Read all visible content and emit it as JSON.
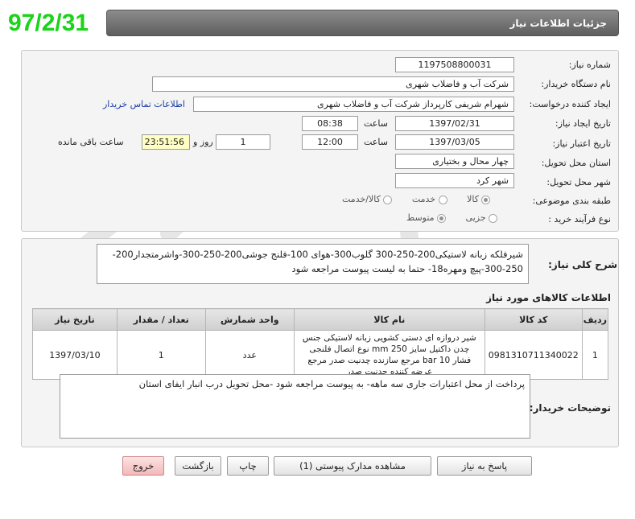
{
  "date_stamp": "97/2/31",
  "header": {
    "title": "جزئیات اطلاعات نیاز"
  },
  "form": {
    "need_number_label": "شماره نیاز:",
    "need_number": "1197508800031",
    "buyer_org_label": "نام دستگاه خریدار:",
    "buyer_org": "شرکت آب و فاضلاب شهری",
    "requester_label": "ایجاد کننده درخواست:",
    "requester": "شهرام  شریفی  کارپرداز  شرکت آب و فاضلاب شهری",
    "buyer_contact_link": "اطلاعات تماس خریدار",
    "created_label": "تاریخ ایجاد نیاز:",
    "created_date": "1397/02/31",
    "time_label": "ساعت",
    "created_time": "08:38",
    "validity_label": "تاریخ اعتبار نیاز:",
    "validity_date": "1397/03/05",
    "validity_time": "12:00",
    "days_remaining": "1",
    "day_and_label": "روز و",
    "time_remaining": "23:51:56",
    "time_remaining_label": "ساعت باقی مانده",
    "province_label": "استان محل تحویل:",
    "province": "چهار محال و بختیاری",
    "city_label": "شهر محل تحویل:",
    "city": "شهر کرد",
    "category_label": "طبقه بندی موضوعی:",
    "category_options": [
      "کالا",
      "خدمت",
      "کالا/خدمت"
    ],
    "category_selected": "کالا",
    "process_label": "نوع فرآیند خرید :",
    "process_options": [
      "جزیی",
      "متوسط"
    ],
    "process_selected": "متوسط"
  },
  "description": {
    "label": "شرح کلی نیاز:",
    "text": "شیرفلکه زبانه لاستیکی200-250-300 گلوب300-هوای 100-فلنج جوشی200-250-300-واشرمتجدار200-250-300-پیچ ومهره18- حتما به لیست پیوست مراجعه شود"
  },
  "goods": {
    "title": "اطلاعات کالاهای مورد نیاز",
    "columns": [
      "ردیف",
      "کد کالا",
      "نام کالا",
      "واحد شمارش",
      "تعداد / مقدار",
      "تاریخ نیاز"
    ],
    "rows": [
      {
        "row": "1",
        "code": "0981310711340022",
        "name": "شیر دروازه ای دستی کشویی زبانه لاستیکی جنس چدن داکتیل سایز 250 mm نوع اتصال فلنجی فشار 10 bar مرجع سازنده چدنیت صدر مرجع عرضه کننده چدنیت صدر",
        "unit": "عدد",
        "quantity": "1",
        "date": "1397/03/10"
      }
    ]
  },
  "notes": {
    "label": "توضیحات خریدار:",
    "text": "پرداخت از محل اعتبارات جاری سه ماهه- به پیوست مراجعه شود -محل تحویل درب انبار ایفای استان"
  },
  "buttons": {
    "reply": "پاسخ به نیاز",
    "attachments": "مشاهده مدارک پیوستی (1)",
    "print": "چاپ",
    "back": "بازگشت",
    "exit": "خروج"
  },
  "colors": {
    "date_stamp": "#19d419",
    "header_bg": "#6e6e6e",
    "link": "#1a3da8",
    "watermark": "#c8c8c8"
  }
}
